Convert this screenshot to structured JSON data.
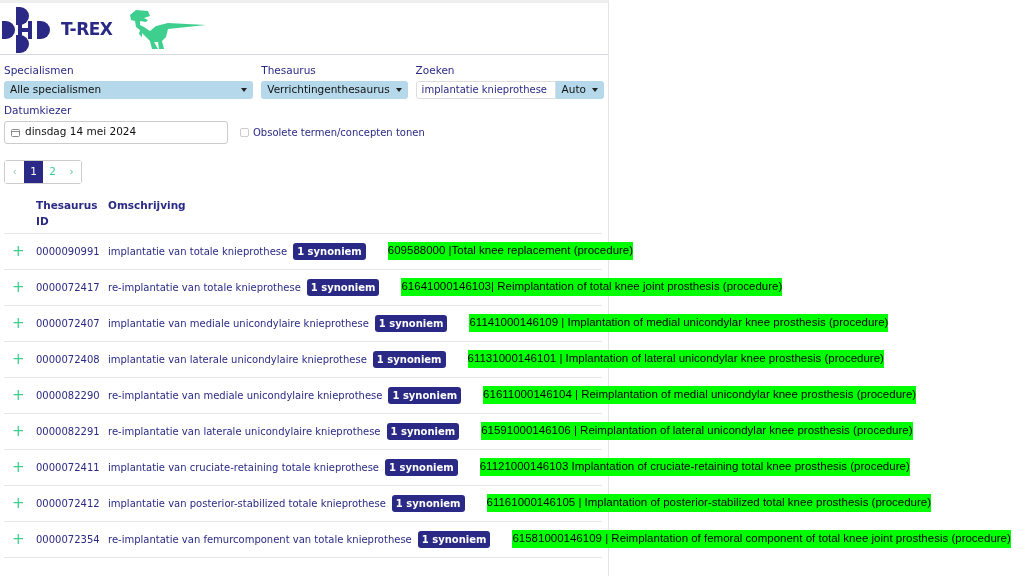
{
  "header": {
    "app_name": "T-REX"
  },
  "filters": {
    "specialism": {
      "label": "Specialismen",
      "value": "Alle specialismen"
    },
    "thesaurus": {
      "label": "Thesaurus",
      "value": "Verrichtingenthesaurus"
    },
    "search": {
      "label": "Zoeken",
      "value": "implantatie knieprothese",
      "mode": "Auto"
    },
    "date": {
      "label": "Datumkiezer",
      "value": "dinsdag 14 mei 2024"
    },
    "obsolete": {
      "label": "Obsolete termen/concepten tonen",
      "checked": false
    }
  },
  "pagination": {
    "prev": {
      "label": "‹",
      "disabled": true
    },
    "pages": [
      {
        "label": "1",
        "selected": true
      },
      {
        "label": "2",
        "selected": false
      }
    ],
    "next": {
      "label": "›",
      "disabled": false
    }
  },
  "table": {
    "columns": [
      "Thesaurus ID",
      "Omschrijving"
    ],
    "rows": [
      {
        "expand": "+",
        "id": "0000090991",
        "description": "implantatie van totale knieprothese",
        "badge": "1 synoniem",
        "annotation": "609588000 |Total knee replacement (procedure)"
      },
      {
        "expand": "+",
        "id": "0000072417",
        "description": "re-implantatie van totale knieprothese",
        "badge": "1 synoniem",
        "annotation": "61641000146103| Reimplantation of total knee joint prosthesis (procedure)"
      },
      {
        "expand": "+",
        "id": "0000072407",
        "description": "implantatie van mediale unicondylaire knieprothese",
        "badge": "1 synoniem",
        "annotation": "61141000146109 | Implantation of medial unicondylar knee prosthesis (procedure)"
      },
      {
        "expand": "+",
        "id": "0000072408",
        "description": "implantatie van laterale unicondylaire knieprothese",
        "badge": "1 synoniem",
        "annotation": "61131000146101 | Implantation of lateral unicondylar knee prosthesis (procedure)"
      },
      {
        "expand": "+",
        "id": "0000082290",
        "description": "re-implantatie van mediale unicondylaire knieprothese",
        "badge": "1 synoniem",
        "annotation": "61611000146104 | Reimplantation of medial unicondylar knee prosthesis (procedure)"
      },
      {
        "expand": "+",
        "id": "0000082291",
        "description": "re-implantatie van laterale unicondylaire knieprothese",
        "badge": "1 synoniem",
        "annotation": "61591000146106 | Reimplantation of lateral unicondylar knee prosthesis (procedure)"
      },
      {
        "expand": "+",
        "id": "0000072411",
        "description": "implantatie van cruciate-retaining totale knieprothese",
        "badge": "1 synoniem",
        "annotation": "61121000146103 Implantation of cruciate-retaining total knee prosthesis (procedure)"
      },
      {
        "expand": "+",
        "id": "0000072412",
        "description": "implantatie van posterior-stabilized totale knieprothese",
        "badge": "1 synoniem",
        "annotation": "61161000146105 | Implantation of posterior-stabilized total knee prosthesis (procedure)"
      },
      {
        "expand": "+",
        "id": "0000072354",
        "description": "re-implantatie van femurcomponent van totale knieprothese",
        "badge": "1 synoniem",
        "annotation": "61581000146109 | Reimplantation of femoral component of total knee joint prosthesis (procedure)"
      }
    ]
  }
}
